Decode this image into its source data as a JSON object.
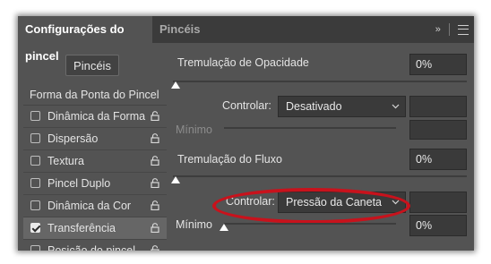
{
  "tabs": {
    "active": "Configurações do pincel",
    "inactive": "Pincéis",
    "menu_icons": "»"
  },
  "brushes_button": "Pincéis",
  "sidebar": {
    "heading": "Forma da Ponta do Pincel",
    "items": [
      {
        "label": "Dinâmica da Forma",
        "checked": false
      },
      {
        "label": "Dispersão",
        "checked": false
      },
      {
        "label": "Textura",
        "checked": false
      },
      {
        "label": "Pincel Duplo",
        "checked": false
      },
      {
        "label": "Dinâmica da Cor",
        "checked": false
      },
      {
        "label": "Transferência",
        "checked": true
      },
      {
        "label": "Posição do pincel",
        "checked": false
      }
    ]
  },
  "opacity": {
    "label": "Tremulação de Opacidade",
    "value": "0%",
    "control_label": "Controlar:",
    "control_value": "Desativado",
    "minimum_label": "Mínimo",
    "slider_level": 0
  },
  "flow": {
    "label": "Tremulação do Fluxo",
    "value": "0%",
    "control_label": "Controlar:",
    "control_value": "Pressão da Caneta",
    "minimum_label": "Mínimo",
    "minimum_value": "0%",
    "slider_level": 0
  },
  "colors": {
    "panel": "#535353",
    "highlight_ring": "#c8121c"
  }
}
